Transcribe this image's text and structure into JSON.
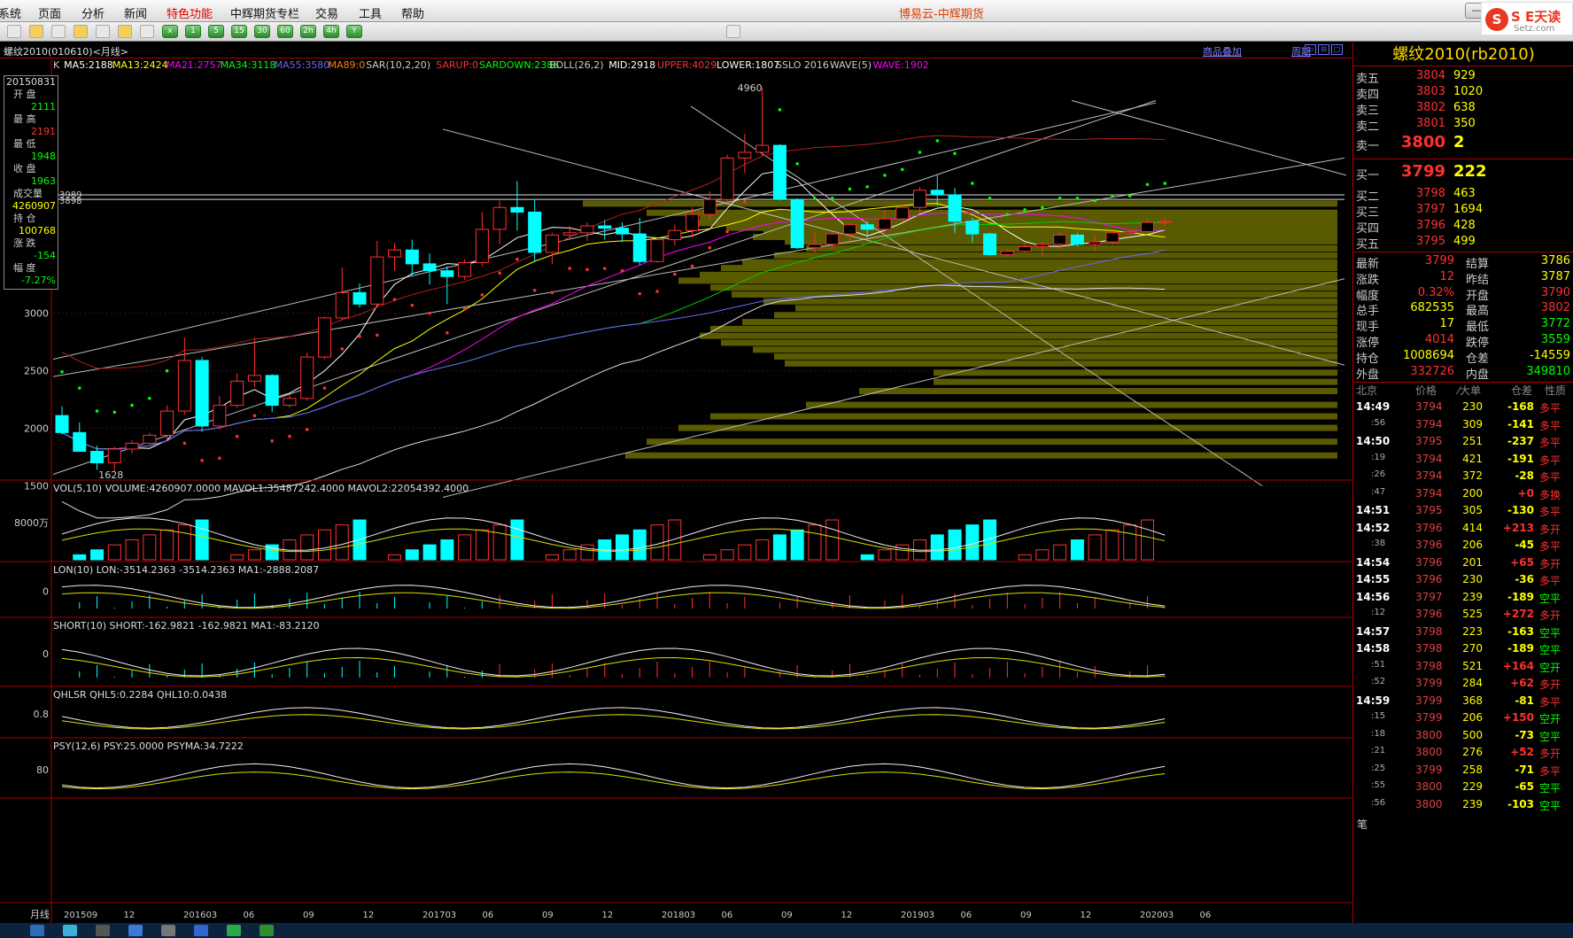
{
  "app_title": "博易云-中辉期货",
  "logo": {
    "text": "S E天读",
    "url": "Setz.com"
  },
  "menu": [
    "系统",
    "页面",
    "分析",
    "新闻",
    "特色功能",
    "中辉期货专栏",
    "交易",
    "工具",
    "帮助"
  ],
  "toolbar_icons": [
    "grid",
    "pattern",
    "ticks",
    "day",
    "week",
    "month",
    "season",
    "x",
    "1",
    "5",
    "15",
    "30",
    "60",
    "2h",
    "4h",
    "Y",
    "calendar"
  ],
  "contract_label": "螺纹2010(010610)<月线>",
  "overlay_link": "商品叠加",
  "period_link": "周期",
  "indicators_line": [
    {
      "t": "K",
      "c": "#cccccc"
    },
    {
      "t": "MA5:2188",
      "c": "#ffffff"
    },
    {
      "t": "MA13:2424",
      "c": "#ffff00"
    },
    {
      "t": "MA21:2757",
      "c": "#ff00ff"
    },
    {
      "t": "MA34:3118",
      "c": "#00ff00"
    },
    {
      "t": "MA55:3580",
      "c": "#6666ff"
    },
    {
      "t": "MA89:0",
      "c": "#ff8000"
    },
    {
      "t": "SAR(10,2,20)",
      "c": "#cccccc"
    },
    {
      "t": "SARUP:0",
      "c": "#ff3030"
    },
    {
      "t": "SARDOWN:2386",
      "c": "#00ff00"
    },
    {
      "t": "BOLL(26,2)",
      "c": "#cccccc"
    },
    {
      "t": "MID:2918",
      "c": "#ffffff"
    },
    {
      "t": "UPPER:4029",
      "c": "#ff3030"
    },
    {
      "t": "LOWER:1807",
      "c": "#ffffff"
    },
    {
      "t": "SSLO 2016",
      "c": "#cccccc"
    },
    {
      "t": "WAVE(5)",
      "c": "#cccccc"
    },
    {
      "t": "WAVE:1902",
      "c": "#ff00ff"
    }
  ],
  "info_box": {
    "date": "20150831",
    "rows": [
      {
        "label": "开 盘",
        "value": "2111",
        "color": "#00ff00"
      },
      {
        "label": "最 高",
        "value": "2191",
        "color": "#ff3030"
      },
      {
        "label": "最 低",
        "value": "1948",
        "color": "#00ff00"
      },
      {
        "label": "收 盘",
        "value": "1963",
        "color": "#00ff00"
      },
      {
        "label": "成交量",
        "value": "4260907",
        "color": "#ffff00"
      },
      {
        "label": "持 仓",
        "value": "100768",
        "color": "#ffff00"
      },
      {
        "label": "涨 跌",
        "value": "-154",
        "color": "#00ff00"
      },
      {
        "label": "幅 度",
        "value": "-7.27%",
        "color": "#00ff00"
      }
    ]
  },
  "chart_data": {
    "type": "candlestick",
    "title": "螺纹2010(010610)<月线>",
    "y_ticks": [
      "3000",
      "2500",
      "2000",
      "1500"
    ],
    "ylim": [
      1550,
      5000
    ],
    "x_ticks": [
      "201509",
      "12",
      "201603",
      "06",
      "09",
      "12",
      "201703",
      "06",
      "09",
      "12",
      "201803",
      "06",
      "09",
      "12",
      "201903",
      "06",
      "09",
      "12",
      "202003",
      "06"
    ],
    "marks": {
      "high": "4960",
      "low": "1628",
      "price_a": "3989",
      "price_b": "3898"
    },
    "candles": [
      [
        2111,
        2191,
        1948,
        1963
      ],
      [
        1963,
        2050,
        1810,
        1800
      ],
      [
        1800,
        1850,
        1640,
        1700
      ],
      [
        1700,
        1840,
        1628,
        1820
      ],
      [
        1820,
        1900,
        1780,
        1870
      ],
      [
        1870,
        1960,
        1860,
        1940
      ],
      [
        1940,
        2200,
        1900,
        2150
      ],
      [
        2150,
        2790,
        2120,
        2590
      ],
      [
        2590,
        2620,
        1970,
        2020
      ],
      [
        2020,
        2280,
        1990,
        2200
      ],
      [
        2200,
        2480,
        2180,
        2410
      ],
      [
        2410,
        2790,
        2360,
        2460
      ],
      [
        2460,
        2470,
        2140,
        2200
      ],
      [
        2200,
        2290,
        2180,
        2260
      ],
      [
        2260,
        2660,
        2240,
        2620
      ],
      [
        2620,
        2970,
        2600,
        2960
      ],
      [
        2960,
        3400,
        2940,
        3180
      ],
      [
        3180,
        3260,
        3050,
        3080
      ],
      [
        3080,
        3630,
        3060,
        3490
      ],
      [
        3490,
        3610,
        3370,
        3550
      ],
      [
        3550,
        3640,
        3320,
        3430
      ],
      [
        3430,
        3520,
        3250,
        3370
      ],
      [
        3370,
        3410,
        3080,
        3320
      ],
      [
        3320,
        3470,
        3290,
        3440
      ],
      [
        3440,
        3880,
        3410,
        3730
      ],
      [
        3730,
        3980,
        3600,
        3920
      ],
      [
        3920,
        4150,
        3720,
        3880
      ],
      [
        3880,
        3990,
        3450,
        3530
      ],
      [
        3530,
        3700,
        3430,
        3680
      ],
      [
        3680,
        3760,
        3640,
        3700
      ],
      [
        3700,
        3790,
        3630,
        3760
      ],
      [
        3760,
        3810,
        3640,
        3740
      ],
      [
        3740,
        3790,
        3620,
        3690
      ],
      [
        3690,
        3830,
        3420,
        3450
      ],
      [
        3450,
        3660,
        3440,
        3640
      ],
      [
        3640,
        3770,
        3590,
        3720
      ],
      [
        3720,
        3920,
        3660,
        3860
      ],
      [
        3860,
        4060,
        3820,
        3990
      ],
      [
        3990,
        4380,
        3960,
        4350
      ],
      [
        4350,
        4560,
        4220,
        4400
      ],
      [
        4400,
        4960,
        4370,
        4460
      ],
      [
        4460,
        4470,
        3980,
        3990
      ],
      [
        3990,
        4000,
        3560,
        3570
      ],
      [
        3570,
        3700,
        3530,
        3600
      ],
      [
        3600,
        3700,
        3560,
        3690
      ],
      [
        3690,
        3780,
        3630,
        3770
      ],
      [
        3770,
        3800,
        3660,
        3730
      ],
      [
        3730,
        3900,
        3700,
        3820
      ],
      [
        3820,
        3950,
        3800,
        3920
      ],
      [
        3920,
        4100,
        3870,
        4070
      ],
      [
        4070,
        4200,
        3940,
        4030
      ],
      [
        4030,
        4090,
        3700,
        3800
      ],
      [
        3800,
        3830,
        3620,
        3690
      ],
      [
        3690,
        3700,
        3500,
        3510
      ],
      [
        3510,
        3560,
        3490,
        3540
      ],
      [
        3540,
        3600,
        3530,
        3580
      ],
      [
        3580,
        3620,
        3500,
        3600
      ],
      [
        3600,
        3700,
        3560,
        3680
      ],
      [
        3680,
        3700,
        3580,
        3600
      ],
      [
        3600,
        3680,
        3540,
        3620
      ],
      [
        3620,
        3720,
        3600,
        3700
      ],
      [
        3700,
        3720,
        3680,
        3710
      ],
      [
        3710,
        3820,
        3700,
        3790
      ],
      [
        3790,
        3830,
        3760,
        3799
      ]
    ],
    "volume": {
      "label": "VOL(5,10) VOLUME:4260907.0000 MAVOL1:35487242.4000 MAVOL2:22054392.4000",
      "tick": "8000万"
    },
    "lon": {
      "label": "LON(10) LON:-3514.2363 -3514.2363 MA1:-2888.2087",
      "tick": "0"
    },
    "short": {
      "label": "SHORT(10) SHORT:-162.9821 -162.9821 MA1:-83.2120",
      "tick": "0"
    },
    "qhlsr": {
      "label": "QHLSR QHL5:0.2284 QHL10:0.0438",
      "tick": "0.8"
    },
    "psy": {
      "label": "PSY(12,6) PSY:25.0000 PSYMA:34.7222",
      "tick": "80"
    },
    "x_axis_label": "月线"
  },
  "quote": {
    "title": "螺纹2010(rb2010)",
    "asks": [
      {
        "label": "卖五",
        "price": "3804",
        "vol": "929"
      },
      {
        "label": "卖四",
        "price": "3803",
        "vol": "1020"
      },
      {
        "label": "卖三",
        "price": "3802",
        "vol": "638"
      },
      {
        "label": "卖二",
        "price": "3801",
        "vol": "350"
      },
      {
        "label": "卖一",
        "price": "3800",
        "vol": "2"
      }
    ],
    "bids": [
      {
        "label": "买一",
        "price": "3799",
        "vol": "222"
      },
      {
        "label": "买二",
        "price": "3798",
        "vol": "463"
      },
      {
        "label": "买三",
        "price": "3797",
        "vol": "1694"
      },
      {
        "label": "买四",
        "price": "3796",
        "vol": "428"
      },
      {
        "label": "买五",
        "price": "3795",
        "vol": "499"
      }
    ],
    "stats": [
      {
        "l1": "最新",
        "v1": "3799",
        "c1": "#ff3030",
        "l2": "结算",
        "v2": "3786",
        "c2": "#ffff00"
      },
      {
        "l1": "涨跌",
        "v1": "12",
        "c1": "#ff3030",
        "l2": "昨结",
        "v2": "3787",
        "c2": "#ffff00"
      },
      {
        "l1": "幅度",
        "v1": "0.32%",
        "c1": "#ff3030",
        "l2": "开盘",
        "v2": "3790",
        "c2": "#ff3030"
      },
      {
        "l1": "总手",
        "v1": "682535",
        "c1": "#ffff00",
        "l2": "最高",
        "v2": "3802",
        "c2": "#ff3030"
      },
      {
        "l1": "现手",
        "v1": "17",
        "c1": "#ffff00",
        "l2": "最低",
        "v2": "3772",
        "c2": "#00ff00"
      },
      {
        "l1": "涨停",
        "v1": "4014",
        "c1": "#ff3030",
        "l2": "跌停",
        "v2": "3559",
        "c2": "#00ff00"
      },
      {
        "l1": "持仓",
        "v1": "1008694",
        "c1": "#ffff00",
        "l2": "仓差",
        "v2": "-14559",
        "c2": "#ffff00"
      },
      {
        "l1": "外盘",
        "v1": "332726",
        "c1": "#ff3030",
        "l2": "内盘",
        "v2": "349810",
        "c2": "#00ff00"
      }
    ],
    "tick_header": [
      "北京",
      "价格",
      "⁄大单",
      "仓差",
      "性质"
    ],
    "ticks": [
      {
        "t": "14:49",
        "p": "3794",
        "v": "230",
        "d": "-168",
        "n": "多平",
        "nc": "#ff3030"
      },
      {
        "t": ":56",
        "p": "3794",
        "v": "309",
        "d": "-141",
        "n": "多平",
        "nc": "#ff3030"
      },
      {
        "t": "14:50",
        "p": "3795",
        "v": "251",
        "d": "-237",
        "n": "多平",
        "nc": "#ff3030"
      },
      {
        "t": ":19",
        "p": "3794",
        "v": "421",
        "d": "-191",
        "n": "多平",
        "nc": "#ff3030"
      },
      {
        "t": ":26",
        "p": "3794",
        "v": "372",
        "d": "-28",
        "n": "多平",
        "nc": "#ff3030"
      },
      {
        "t": ":47",
        "p": "3794",
        "v": "200",
        "d": "+0",
        "n": "多换",
        "nc": "#ff3030"
      },
      {
        "t": "14:51",
        "p": "3795",
        "v": "305",
        "d": "-130",
        "n": "多平",
        "nc": "#ff3030"
      },
      {
        "t": "14:52",
        "p": "3796",
        "v": "414",
        "d": "+213",
        "n": "多开",
        "nc": "#ff3030"
      },
      {
        "t": ":38",
        "p": "3796",
        "v": "206",
        "d": "-45",
        "n": "多平",
        "nc": "#ff3030"
      },
      {
        "t": "14:54",
        "p": "3796",
        "v": "201",
        "d": "+65",
        "n": "多开",
        "nc": "#ff3030"
      },
      {
        "t": "14:55",
        "p": "3796",
        "v": "230",
        "d": "-36",
        "n": "多平",
        "nc": "#ff3030"
      },
      {
        "t": "14:56",
        "p": "3797",
        "v": "239",
        "d": "-189",
        "n": "空平",
        "nc": "#00ff00"
      },
      {
        "t": ":12",
        "p": "3796",
        "v": "525",
        "d": "+272",
        "n": "多开",
        "nc": "#ff3030"
      },
      {
        "t": "14:57",
        "p": "3798",
        "v": "223",
        "d": "-163",
        "n": "空平",
        "nc": "#00ff00"
      },
      {
        "t": "14:58",
        "p": "3798",
        "v": "270",
        "d": "-189",
        "n": "空平",
        "nc": "#00ff00"
      },
      {
        "t": ":51",
        "p": "3798",
        "v": "521",
        "d": "+164",
        "n": "空开",
        "nc": "#00ff00"
      },
      {
        "t": ":52",
        "p": "3799",
        "v": "284",
        "d": "+62",
        "n": "多开",
        "nc": "#ff3030"
      },
      {
        "t": "14:59",
        "p": "3799",
        "v": "368",
        "d": "-81",
        "n": "多平",
        "nc": "#ff3030"
      },
      {
        "t": ":15",
        "p": "3799",
        "v": "206",
        "d": "+150",
        "n": "空开",
        "nc": "#00ff00"
      },
      {
        "t": ":18",
        "p": "3800",
        "v": "500",
        "d": "-73",
        "n": "空平",
        "nc": "#00ff00"
      },
      {
        "t": ":21",
        "p": "3800",
        "v": "276",
        "d": "+52",
        "n": "多开",
        "nc": "#ff3030"
      },
      {
        "t": ":25",
        "p": "3799",
        "v": "258",
        "d": "-71",
        "n": "多平",
        "nc": "#ff3030"
      },
      {
        "t": ":55",
        "p": "3800",
        "v": "229",
        "d": "-65",
        "n": "空平",
        "nc": "#00ff00"
      },
      {
        "t": ":56",
        "p": "3800",
        "v": "239",
        "d": "-103",
        "n": "空平",
        "nc": "#00ff00"
      }
    ],
    "bottom_tab": "笔"
  }
}
